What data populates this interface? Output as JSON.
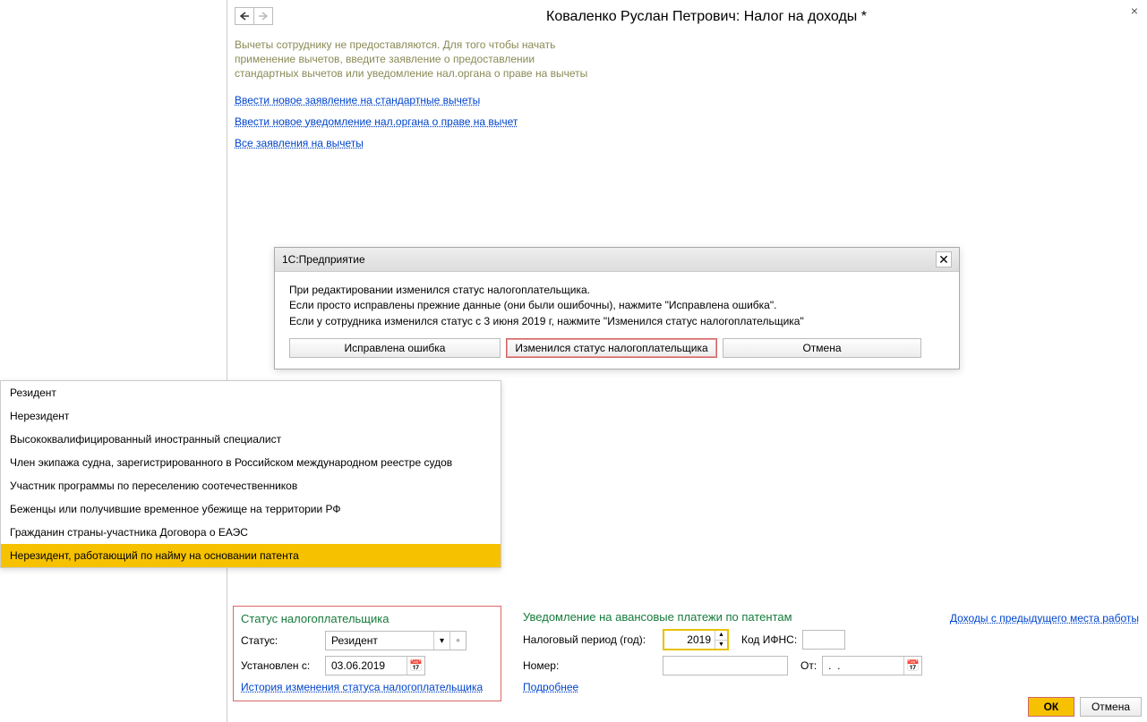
{
  "window": {
    "title": "Коваленко Руслан Петрович: Налог на доходы *",
    "hint": "Вычеты сотруднику не предоставляются. Для того чтобы начать применение вычетов, введите заявление о предоставлении стандартных вычетов или уведомление нал.органа о праве на вычеты",
    "links": {
      "new_standard": "Ввести новое заявление на стандартные вычеты",
      "new_notice": "Ввести новое уведомление нал.органа о праве на вычет",
      "all_apps": "Все заявления на вычеты"
    }
  },
  "modal": {
    "header": "1С:Предприятие",
    "text1": "При редактировании изменился статус налогоплательщика.",
    "text2": "Если просто исправлены прежние данные (они были ошибочны), нажмите \"Исправлена ошибка\".",
    "text3": "Если у сотрудника изменился статус с 3 июня 2019 г, нажмите \"Изменился статус налогоплательщика\"",
    "buttons": {
      "fixed": "Исправлена ошибка",
      "changed": "Изменился статус налогоплательщика",
      "cancel": "Отмена"
    }
  },
  "dropdown": {
    "items": [
      "Резидент",
      "Нерезидент",
      "Высококвалифицированный иностранный специалист",
      "Член экипажа судна, зарегистрированного в Российском международном реестре судов",
      "Участник программы по переселению соотечественников",
      "Беженцы или получившие временное убежище на территории РФ",
      "Гражданин страны-участника Договора о ЕАЭС",
      "Нерезидент, работающий по найму на основании патента"
    ]
  },
  "taxpayer": {
    "section_title": "Статус налогоплательщика",
    "status_label": "Статус:",
    "status_value": "Резидент",
    "set_from_label": "Установлен с:",
    "set_from_value": "03.06.2019",
    "history_link": "История изменения статуса налогоплательщика"
  },
  "advance": {
    "section_title": "Уведомление на авансовые платежи по патентам",
    "period_label": "Налоговый период (год):",
    "period_value": "2019",
    "ifns_label": "Код ИФНС:",
    "number_label": "Номер:",
    "from_label": "От:",
    "from_value": ".  .",
    "more_link": "Подробнее"
  },
  "right_link": "Доходы с предыдущего места работы",
  "footer": {
    "ok": "ОК",
    "cancel": "Отмена"
  }
}
